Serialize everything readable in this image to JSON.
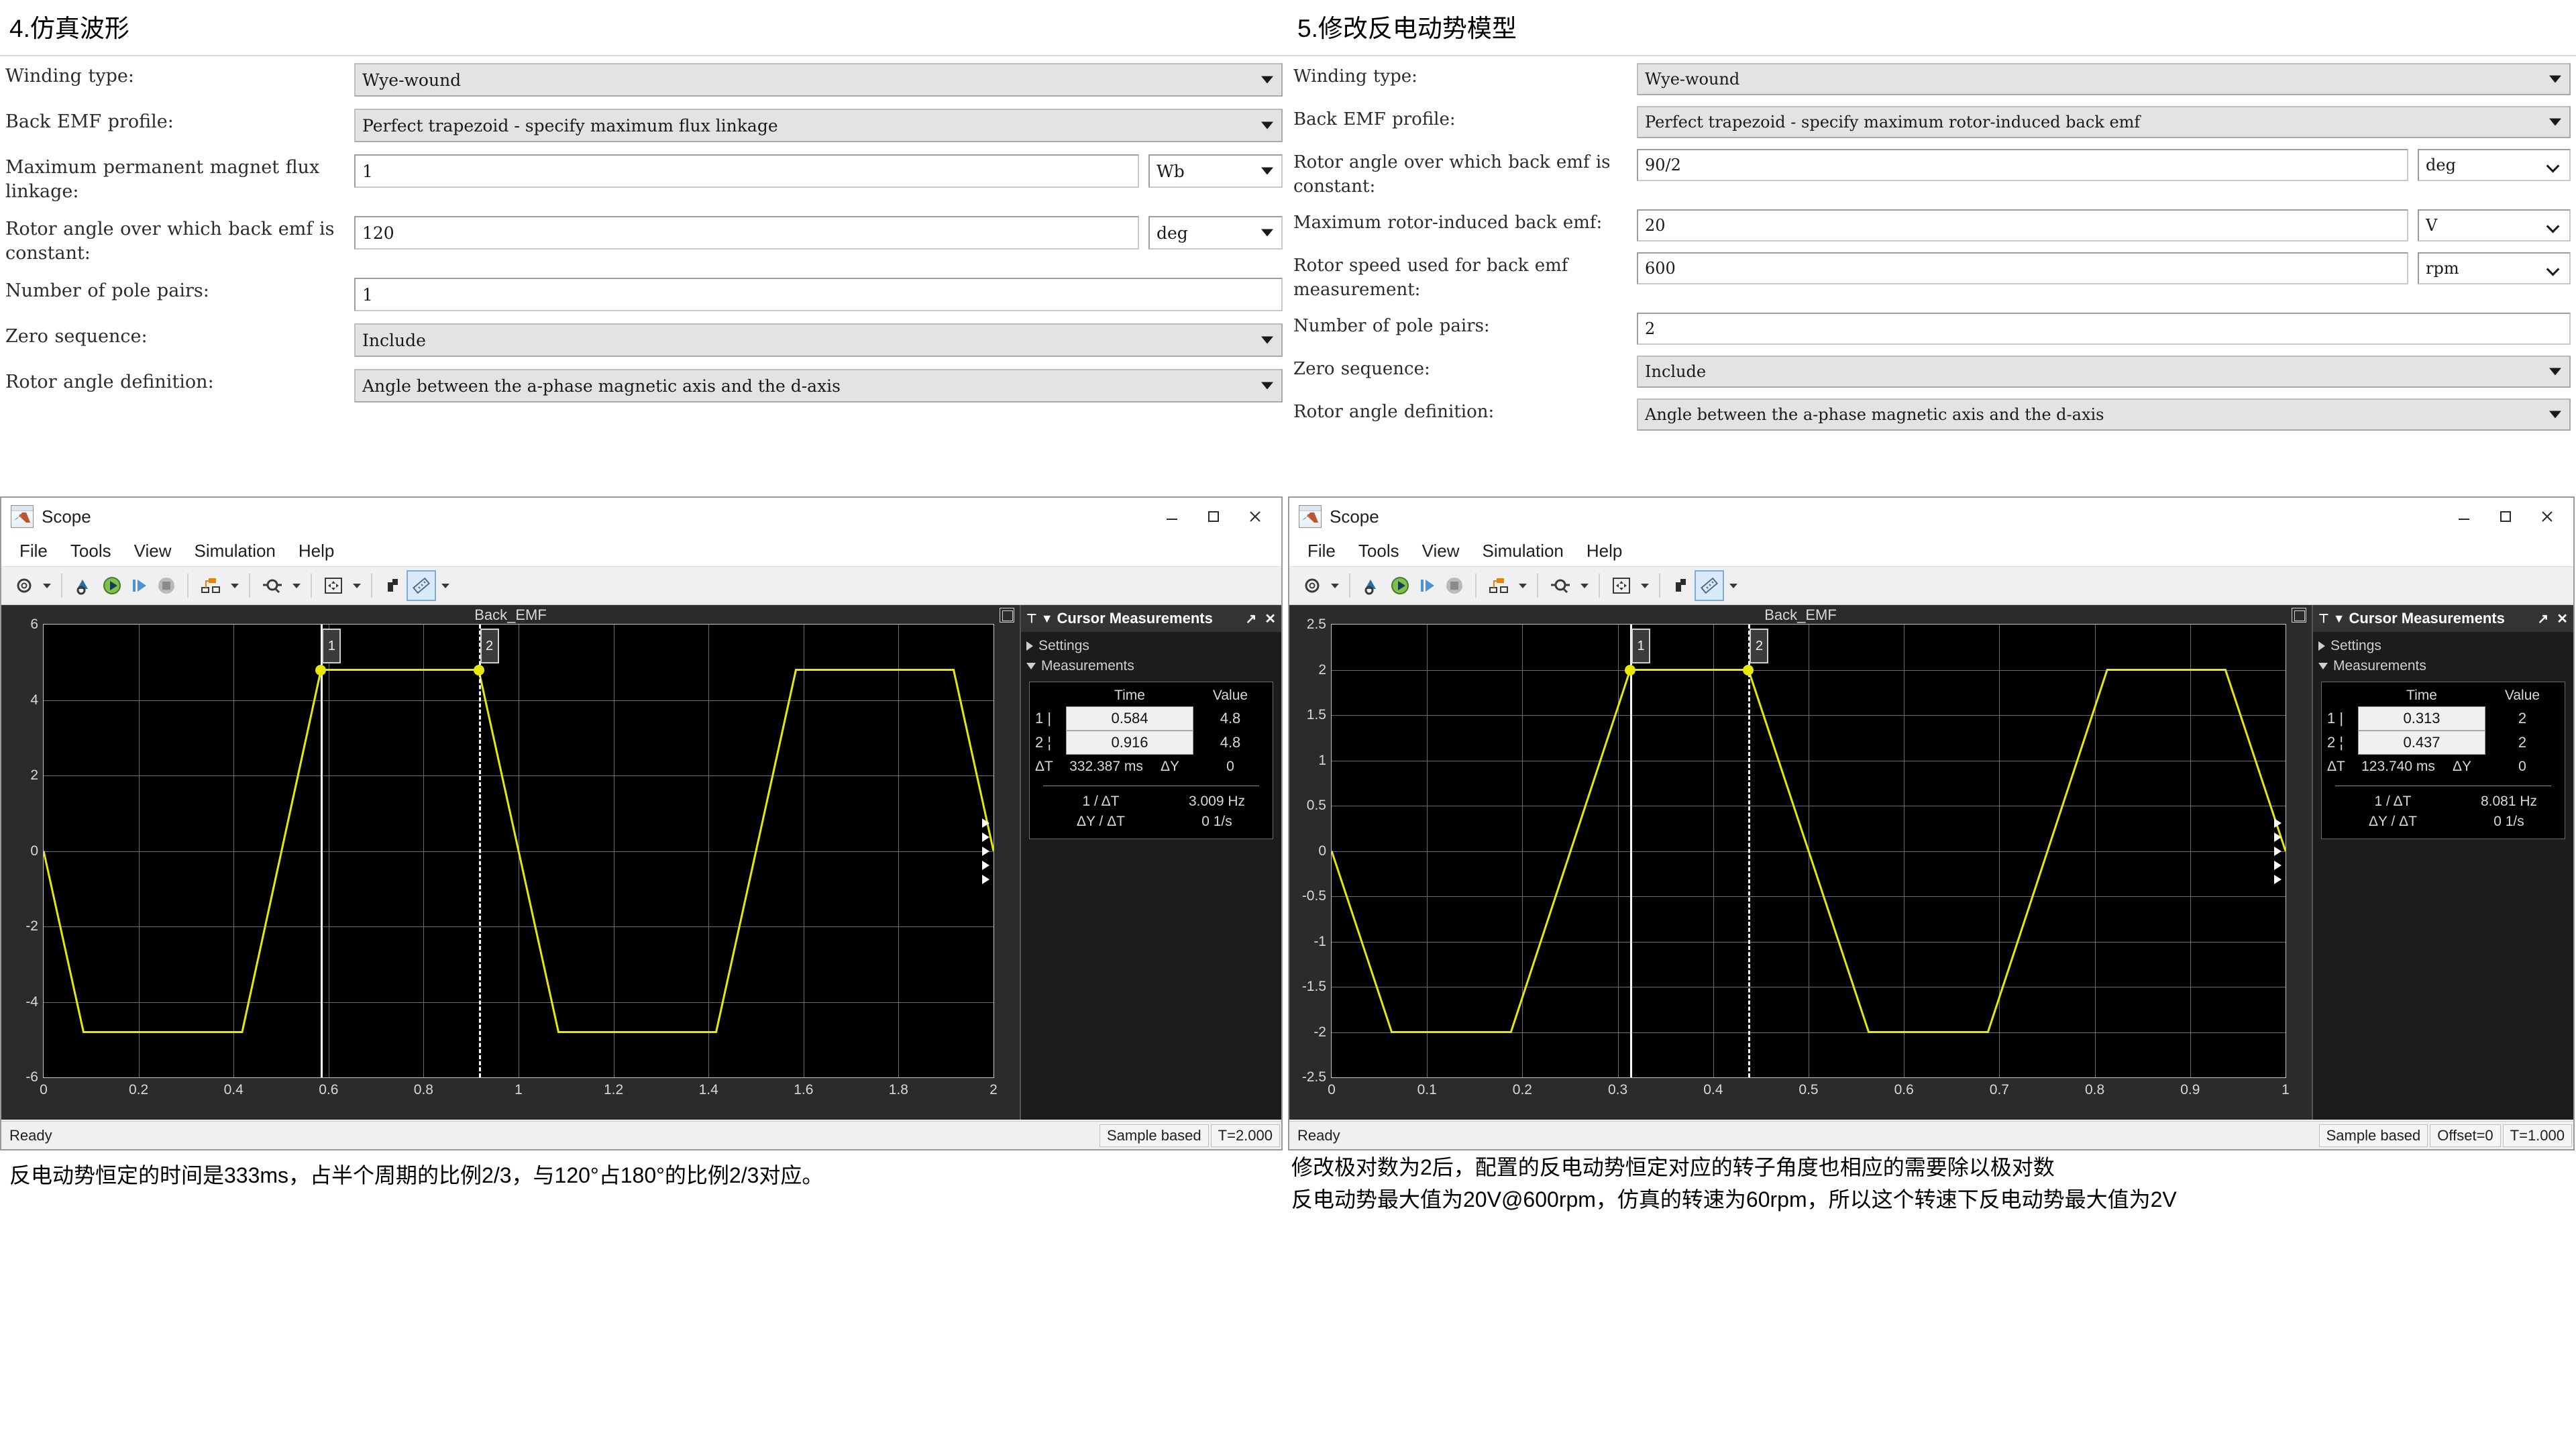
{
  "left_panel": {
    "section_title": "4.仿真波形",
    "fields": [
      {
        "label": "Winding type:",
        "type": "combo",
        "value": "Wye-wound"
      },
      {
        "label": "Back EMF profile:",
        "type": "combo",
        "value": "Perfect trapezoid - specify maximum flux linkage"
      },
      {
        "label": "Maximum permanent magnet flux linkage:",
        "type": "text",
        "value": "1",
        "unit": "Wb"
      },
      {
        "label": "Rotor angle over which back emf is constant:",
        "type": "text",
        "value": "120",
        "unit": "deg"
      },
      {
        "label": "Number of pole pairs:",
        "type": "text",
        "value": "1",
        "unit": ""
      },
      {
        "label": "Zero sequence:",
        "type": "combo",
        "value": "Include"
      },
      {
        "label": "Rotor angle definition:",
        "type": "combo",
        "value": "Angle between the a-phase magnetic axis and the d-axis"
      }
    ]
  },
  "right_panel": {
    "section_title": "5.修改反电动势模型",
    "fields": [
      {
        "label": "Winding type:",
        "type": "combo",
        "value": "Wye-wound"
      },
      {
        "label": "Back EMF profile:",
        "type": "combo",
        "value": "Perfect trapezoid - specify maximum rotor-induced back emf"
      },
      {
        "label": "Rotor angle over which back emf is constant:",
        "type": "text",
        "value": "90/2",
        "unit": "deg"
      },
      {
        "label": "Maximum rotor-induced back emf:",
        "type": "text",
        "value": "20",
        "unit": "V"
      },
      {
        "label": "Rotor speed used for back emf measurement:",
        "type": "text",
        "value": "600",
        "unit": "rpm"
      },
      {
        "label": "Number of pole pairs:",
        "type": "text",
        "value": "2",
        "unit": ""
      },
      {
        "label": "Zero sequence:",
        "type": "combo",
        "value": "Include"
      },
      {
        "label": "Rotor angle definition:",
        "type": "combo",
        "value": "Angle between the a-phase magnetic axis and the d-axis"
      }
    ]
  },
  "scope_left": {
    "window_title": "Scope",
    "menus": [
      "File",
      "Tools",
      "View",
      "Simulation",
      "Help"
    ],
    "window_buttons": {
      "minimize": "minimize-button",
      "maximize": "maximize-button",
      "close": "close-button"
    },
    "plot_title": "Back_EMF",
    "cursor_panel": {
      "title": "Cursor Measurements",
      "settings_label": "Settings",
      "measurements_label": "Measurements",
      "col_time": "Time",
      "col_value": "Value",
      "rows": [
        {
          "id": "1 |",
          "time": "0.584",
          "value": "4.8"
        },
        {
          "id": "2 ¦",
          "time": "0.916",
          "value": "4.8"
        }
      ],
      "dt_label": "ΔT",
      "dt_value": "332.387 ms",
      "dy_label": "ΔY",
      "dy_value": "0",
      "inv_dt_label": "1 / ΔT",
      "inv_dt_value": "3.009 Hz",
      "slope_label": "ΔY / ΔT",
      "slope_value": "0 1/s"
    },
    "status": {
      "ready": "Ready",
      "cells": [
        "Sample based",
        "T=2.000"
      ]
    }
  },
  "scope_right": {
    "window_title": "Scope",
    "menus": [
      "File",
      "Tools",
      "View",
      "Simulation",
      "Help"
    ],
    "window_buttons": {
      "minimize": "minimize-button",
      "maximize": "maximize-button",
      "close": "close-button"
    },
    "plot_title": "Back_EMF",
    "cursor_panel": {
      "title": "Cursor Measurements",
      "settings_label": "Settings",
      "measurements_label": "Measurements",
      "col_time": "Time",
      "col_value": "Value",
      "rows": [
        {
          "id": "1 |",
          "time": "0.313",
          "value": "2"
        },
        {
          "id": "2 ¦",
          "time": "0.437",
          "value": "2"
        }
      ],
      "dt_label": "ΔT",
      "dt_value": "123.740 ms",
      "dy_label": "ΔY",
      "dy_value": "0",
      "inv_dt_label": "1 / ΔT",
      "inv_dt_value": "8.081 Hz",
      "slope_label": "ΔY / ΔT",
      "slope_value": "0 1/s"
    },
    "status": {
      "ready": "Ready",
      "cells": [
        "Sample based",
        "Offset=0",
        "T=1.000"
      ]
    }
  },
  "caption_left": "反电动势恒定的时间是333ms，占半个周期的比例2/3，与120°占180°的比例2/3对应。",
  "caption_right": "修改极对数为2后，配置的反电动势恒定对应的转子角度也相应的需要除以极对数\n反电动势最大值为20V@600rpm，仿真的转速为60rpm，所以这个转速下反电动势最大值为2V",
  "colors": {
    "trace": "#e8e800",
    "plot_bg": "#000000",
    "panel_bg": "#2b2b2b",
    "cursor": "#ffffff"
  },
  "chart_data": [
    {
      "type": "line",
      "title": "Back_EMF",
      "xlabel": "",
      "ylabel": "",
      "xlim": [
        0,
        2
      ],
      "ylim": [
        -6,
        6
      ],
      "xticks": [
        0,
        0.2,
        0.4,
        0.6,
        0.8,
        1,
        1.2,
        1.4,
        1.6,
        1.8,
        2
      ],
      "xtick_labels": [
        "0",
        "0.2",
        "0.4",
        "0.6",
        "0.8",
        "1",
        "1.2",
        "1.4",
        "1.6",
        "1.8",
        "2"
      ],
      "yticks": [
        -6,
        -4,
        -2,
        0,
        2,
        4,
        6
      ],
      "ytick_labels": [
        "-6",
        "-4",
        "-2",
        "0",
        "2",
        "4",
        "6"
      ],
      "grid": true,
      "legend": null,
      "series": [
        {
          "name": "Back_EMF",
          "color": "#e8e800",
          "x": [
            0,
            0.084,
            0.418,
            0.584,
            0.916,
            1.084,
            1.416,
            1.584,
            1.916,
            2.0
          ],
          "y": [
            0,
            -4.8,
            -4.8,
            4.8,
            4.8,
            -4.8,
            -4.8,
            4.8,
            4.8,
            0
          ]
        }
      ],
      "cursors": [
        {
          "label": "1",
          "x": 0.584,
          "y": 4.8,
          "style": "solid"
        },
        {
          "label": "2",
          "x": 0.916,
          "y": 4.8,
          "style": "dashed"
        }
      ]
    },
    {
      "type": "line",
      "title": "Back_EMF",
      "xlabel": "",
      "ylabel": "",
      "xlim": [
        0,
        1
      ],
      "ylim": [
        -2.5,
        2.5
      ],
      "xticks": [
        0,
        0.1,
        0.2,
        0.3,
        0.4,
        0.5,
        0.6,
        0.7,
        0.8,
        0.9,
        1
      ],
      "xtick_labels": [
        "0",
        "0.1",
        "0.2",
        "0.3",
        "0.4",
        "0.5",
        "0.6",
        "0.7",
        "0.8",
        "0.9",
        "1"
      ],
      "yticks": [
        -2.5,
        -2,
        -1.5,
        -1,
        -0.5,
        0,
        0.5,
        1,
        1.5,
        2,
        2.5
      ],
      "ytick_labels": [
        "-2.5",
        "-2",
        "-1.5",
        "-1",
        "-0.5",
        "0",
        "0.5",
        "1",
        "1.5",
        "2",
        "2.5"
      ],
      "grid": true,
      "legend": null,
      "series": [
        {
          "name": "Back_EMF",
          "color": "#e8e800",
          "x": [
            0,
            0.063,
            0.188,
            0.313,
            0.437,
            0.563,
            0.688,
            0.813,
            0.937,
            1.0
          ],
          "y": [
            0,
            -2,
            -2,
            2,
            2,
            -2,
            -2,
            2,
            2,
            0
          ]
        }
      ],
      "cursors": [
        {
          "label": "1",
          "x": 0.313,
          "y": 2,
          "style": "solid"
        },
        {
          "label": "2",
          "x": 0.437,
          "y": 2,
          "style": "dashed"
        }
      ]
    }
  ]
}
